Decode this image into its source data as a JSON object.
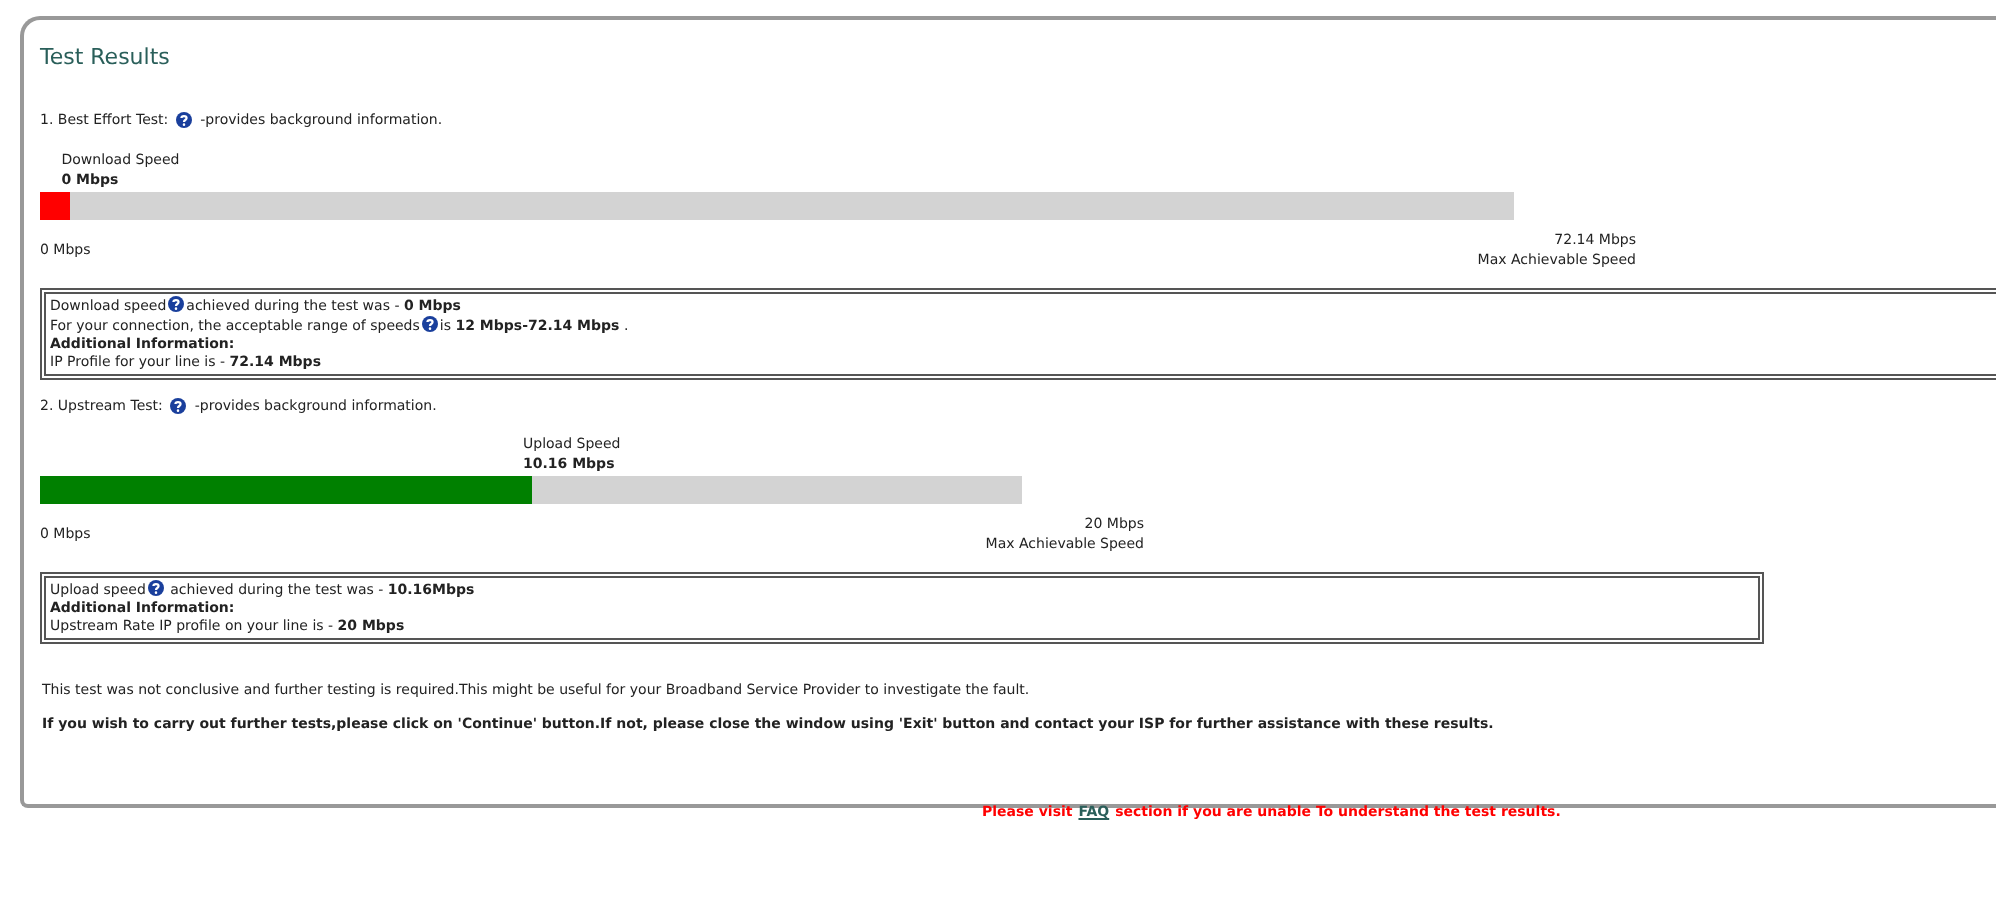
{
  "title": "Test Results",
  "tests": [
    {
      "heading": "1. Best Effort Test:",
      "heading_suffix": "-provides background information.",
      "speed_label": "Download Speed",
      "speed_value": "0 Mbps",
      "level": 0.02,
      "color": "#ff0000",
      "min_label": "0 Mbps",
      "max_value": "72.14 Mbps",
      "max_label": "Max Achievable Speed",
      "info": [
        {
          "kind": "help_line",
          "before": "Download speed",
          "after": "achieved during the test was - **0 Mbps**"
        },
        {
          "kind": "help_line",
          "before": "For your connection, the acceptable range of speeds",
          "after": "is **12 Mbps-72.14 Mbps** ."
        },
        {
          "kind": "heading",
          "text": "Additional Information:"
        },
        {
          "kind": "text_line",
          "text": "IP Profile for your line is - **72.14 Mbps**"
        }
      ]
    },
    {
      "heading": "2. Upstream Test:",
      "heading_suffix": "-provides background information.",
      "speed_label": "Upload Speed",
      "speed_value": "10.16 Mbps",
      "level": 0.5,
      "color": "#008000",
      "min_label": "0 Mbps",
      "max_value": "20 Mbps",
      "max_label": "Max Achievable Speed",
      "info": [
        {
          "kind": "help_line",
          "before": "Upload speed",
          "after": " achieved during the test was - **10.16Mbps**"
        },
        {
          "kind": "heading",
          "text": "Additional Information:"
        },
        {
          "kind": "text_line",
          "text": "Upstream Rate IP profile on your line is - **20 Mbps**"
        }
      ]
    }
  ],
  "note": "This test was not conclusive and further testing is required.This might be useful for your Broadband Service Provider to investigate the fault.",
  "instruction": "If you wish to carry out further tests,please click on 'Continue' button.If not, please close the window using 'Exit' button and contact your ISP for further assistance with these results.",
  "footer": {
    "before": "Please visit",
    "link": "FAQ",
    "after": "section if you are unable To understand the test results."
  }
}
